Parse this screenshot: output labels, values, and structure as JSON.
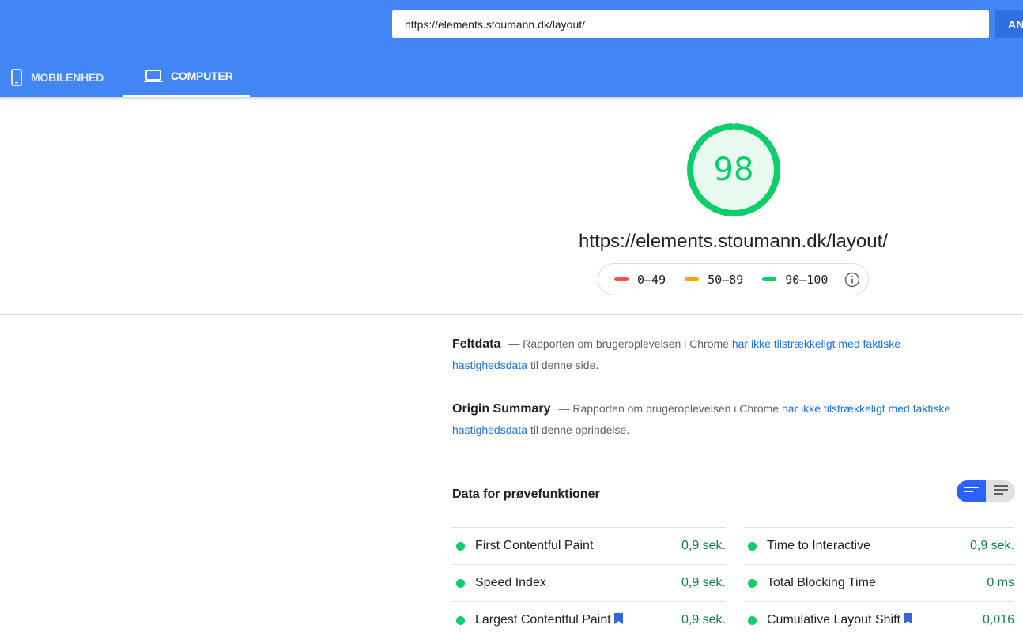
{
  "header": {
    "url_value": "https://elements.stoumann.dk/layout/",
    "analyze_label": "AN",
    "tabs": [
      {
        "label": "MOBILENHED",
        "icon": "phone-icon",
        "active": false
      },
      {
        "label": "COMPUTER",
        "icon": "laptop-icon",
        "active": true
      }
    ]
  },
  "score": {
    "value": "98",
    "fraction": 0.98,
    "color": "#0cce6b"
  },
  "report_url": "https://elements.stoumann.dk/layout/",
  "legend": {
    "items": [
      {
        "range": "0–49",
        "color": "#ff4e42"
      },
      {
        "range": "50–89",
        "color": "#ffa400"
      },
      {
        "range": "90–100",
        "color": "#0cce6b"
      }
    ],
    "info_icon": "info-icon"
  },
  "field_data": {
    "title": "Feltdata",
    "text_before": "— Rapporten om brugeroplevelsen i Chrome ",
    "link": "har ikke tilstrækkeligt med faktiske hastighedsdata",
    "text_after": " til denne side."
  },
  "origin_summary": {
    "title": "Origin Summary",
    "text_before": "— Rapporten om brugeroplevelsen i Chrome ",
    "link": "har ikke tilstrækkeligt med faktiske hastighedsdata",
    "text_after": " til denne oprindelse."
  },
  "lab_data": {
    "title": "Data for prøvefunktioner",
    "metrics": [
      {
        "name": "First Contentful Paint",
        "value": "0,9 sek.",
        "status": "pass"
      },
      {
        "name": "Time to Interactive",
        "value": "0,9 sek.",
        "status": "pass"
      },
      {
        "name": "Speed Index",
        "value": "0,9 sek.",
        "status": "pass"
      },
      {
        "name": "Total Blocking Time",
        "value": "0 ms",
        "status": "pass"
      },
      {
        "name": "Largest Contentful Paint",
        "value": "0,9 sek.",
        "status": "pass",
        "bookmark": true
      },
      {
        "name": "Cumulative Layout Shift",
        "value": "0,016",
        "status": "pass",
        "bookmark": true
      }
    ]
  },
  "colors": {
    "header_bg": "#4285f4",
    "pass_green": "#0cce6b",
    "link_blue": "#1a73e8",
    "toggle_active": "#2962ff"
  }
}
